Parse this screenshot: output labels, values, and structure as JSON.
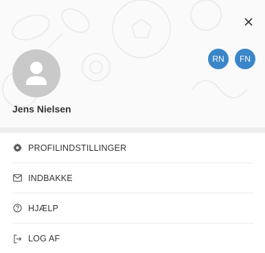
{
  "header": {
    "close_icon": "close-icon",
    "user_name": "Jens Nielsen",
    "badges": [
      {
        "label": "RN",
        "color": "#3a86c8"
      },
      {
        "label": "FN",
        "color": "#3a86c8"
      }
    ]
  },
  "menu": {
    "items": [
      {
        "label": "PROFILINDSTILLINGER",
        "icon": "gear-icon"
      },
      {
        "label": "INDBAKKE",
        "icon": "envelope-icon"
      },
      {
        "label": "HJÆLP",
        "icon": "help-icon"
      },
      {
        "label": "LOG AF",
        "icon": "logout-icon"
      }
    ]
  }
}
